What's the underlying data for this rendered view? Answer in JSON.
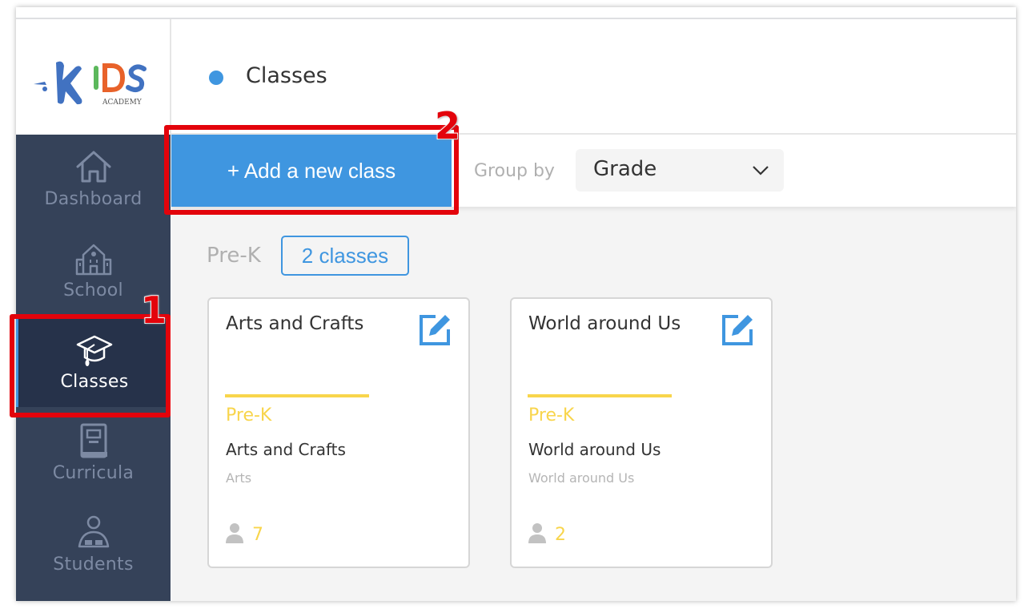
{
  "app": {
    "logo": {
      "main": "KIDS",
      "sub": "ACADEMY"
    }
  },
  "sidebar": {
    "items": [
      {
        "label": "Dashboard",
        "icon": "house-icon",
        "active": false
      },
      {
        "label": "School",
        "icon": "school-building-icon",
        "active": false
      },
      {
        "label": "Classes",
        "icon": "graduation-cap-icon",
        "active": true
      },
      {
        "label": "Curricula",
        "icon": "book-icon",
        "active": false
      },
      {
        "label": "Students",
        "icon": "student-reading-icon",
        "active": false
      }
    ]
  },
  "header": {
    "title": "Classes"
  },
  "toolbar": {
    "add_button_label": "+ Add a new class",
    "group_by_label": "Group by",
    "group_by_value": "Grade"
  },
  "groups": [
    {
      "grade": "Pre-K",
      "count_label": "2 classes",
      "classes": [
        {
          "title": "Arts and Crafts",
          "grade": "Pre-K",
          "name": "Arts and Crafts",
          "subject": "Arts",
          "students": "7"
        },
        {
          "title": "World around Us",
          "grade": "Pre-K",
          "name": "World around Us",
          "subject": "World around Us",
          "students": "2"
        }
      ]
    }
  ],
  "annotations": [
    {
      "number": "1",
      "target": "sidebar Classes item"
    },
    {
      "number": "2",
      "target": "Add a new class button"
    }
  ],
  "colors": {
    "accent": "#3f96e0",
    "sidebar": "#354259",
    "sidebar_active": "#26324a",
    "grade_yellow": "#f8d54c",
    "highlight_red": "#e3030b"
  }
}
